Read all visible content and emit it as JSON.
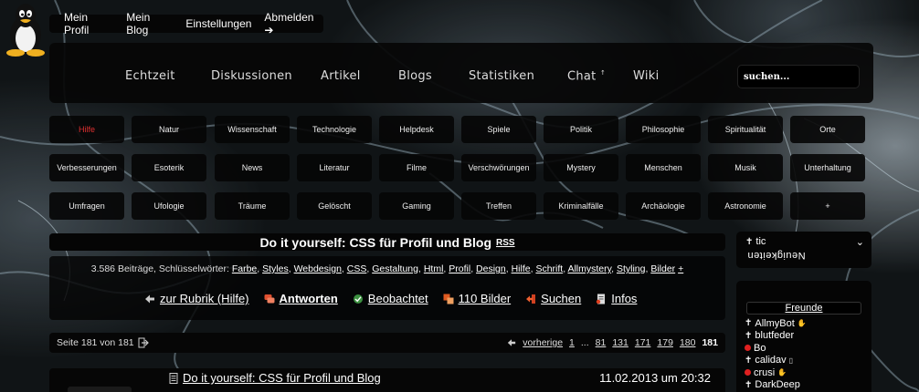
{
  "topbar": {
    "links": [
      "Mein Profil",
      "Mein Blog",
      "Einstellungen",
      "Abmelden ➔"
    ]
  },
  "mainnav": {
    "items": [
      "Echtzeit",
      "Diskussionen",
      "Artikel",
      "Blogs",
      "Statistiken",
      "Chat",
      "Wiki"
    ],
    "chat_suffix": "↑",
    "search_placeholder": "suchen..."
  },
  "categories": {
    "row1": [
      "Hilfe",
      "Natur",
      "Wissenschaft",
      "Technologie",
      "Helpdesk",
      "Spiele",
      "Politik",
      "Philosophie",
      "Spiritualität",
      "Orte"
    ],
    "row2": [
      "Verbesserungen",
      "Esoterik",
      "News",
      "Literatur",
      "Filme",
      "Verschwörungen",
      "Mystery",
      "Menschen",
      "Musik",
      "Unterhaltung"
    ],
    "row3": [
      "Umfragen",
      "Ufologie",
      "Träume",
      "Gelöscht",
      "Gaming",
      "Treffen",
      "Kriminalfälle",
      "Archäologie",
      "Astronomie",
      "+"
    ],
    "active": "Hilfe",
    "active_color": "#e03030"
  },
  "thread": {
    "title": "Do it yourself: CSS für Profil und Blog",
    "rss": "RSS",
    "tags_prefix": "3.586 Beiträge, Schlüsselwörter:",
    "tags": [
      "Farbe",
      "Styles",
      "Webdesign",
      "CSS",
      "Gestaltung",
      "Html",
      "Profil",
      "Design",
      "Hilfe",
      "Schrift",
      "Allmystery",
      "Styling",
      "Bilder"
    ],
    "tags_more": "+",
    "actions": {
      "back": "zur Rubrik (Hilfe)",
      "reply": "Antworten",
      "watched": "Beobachtet",
      "images": "110 Bilder",
      "search": "Suchen",
      "info": "Infos"
    }
  },
  "pagination": {
    "position": "Seite 181 von 181",
    "prev": "vorherige",
    "pages": [
      "1",
      "...",
      "81",
      "131",
      "171",
      "179",
      "180",
      "181"
    ],
    "current": "181"
  },
  "post": {
    "title": "Do it yourself: CSS für Profil und Blog",
    "date": "11.02.2013 um 20:32"
  },
  "user": {
    "name": "tic",
    "status": "Neuigkeiten"
  },
  "friends": {
    "heading": "Freunde",
    "list": [
      {
        "name": "AllmyBot",
        "state": "online",
        "extra": "hand"
      },
      {
        "name": "blutfeder",
        "state": "online",
        "extra": ""
      },
      {
        "name": "Bo",
        "state": "busy",
        "extra": ""
      },
      {
        "name": "calidav",
        "state": "online",
        "extra": "phone"
      },
      {
        "name": "crusi",
        "state": "busy",
        "extra": "hand"
      },
      {
        "name": "DarkDeep",
        "state": "online",
        "extra": ""
      }
    ]
  }
}
